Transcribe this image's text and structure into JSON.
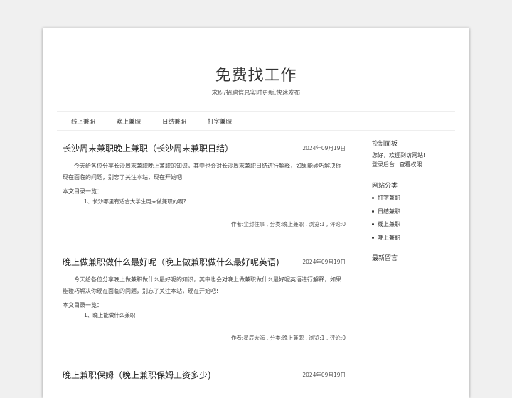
{
  "site": {
    "title": "免费找工作",
    "description": "求职/招聘信息实时更新,快速发布"
  },
  "nav": {
    "items": [
      "线上兼职",
      "晚上兼职",
      "日结兼职",
      "打字兼职"
    ]
  },
  "posts": [
    {
      "title": "长沙周末兼职晚上兼职（长沙周末兼职日结）",
      "date": "2024年09月19日",
      "excerpt": "今天给各位分享长沙周末兼职晚上兼职的知识，其中也会对长沙周末兼职日结进行解释，如果能碰巧解决你现在面临的问题，别忘了关注本站，现在开始吧!",
      "toc_label": "本文目录一览：",
      "toc_items": [
        "1、长沙哪里有适合大学生周末做兼职的啊?"
      ],
      "meta": "作者:尘封往事 , 分类:晚上兼职 , 浏览:1 , 评论:0"
    },
    {
      "title": "晚上做兼职做什么最好呢（晚上做兼职做什么最好呢英语)",
      "date": "2024年09月19日",
      "excerpt": "今天给各位分享晚上做兼职做什么最好呢的知识，其中也会对晚上做兼职做什么最好呢英语进行解释，如果能碰巧解决你现在面临的问题，别忘了关注本站，现在开始吧!",
      "toc_label": "本文目录一览：",
      "toc_items": [
        "1、晚上能做什么兼职"
      ],
      "meta": "作者:星辰大海 , 分类:晚上兼职 , 浏览:1 , 评论:0"
    },
    {
      "title": "晚上兼职保姆（晚上兼职保姆工资多少)",
      "date": "2024年09月19日"
    }
  ],
  "sidebar": {
    "control_panel": {
      "title": "控制面板",
      "welcome": "您好，欢迎到访网站!",
      "login": "登录后台",
      "permissions": "查看权限"
    },
    "categories": {
      "title": "网站分类",
      "items": [
        "打字兼职",
        "日结兼职",
        "线上兼职",
        "晚上兼职"
      ]
    },
    "recent_comments": {
      "title": "最新留言"
    }
  }
}
